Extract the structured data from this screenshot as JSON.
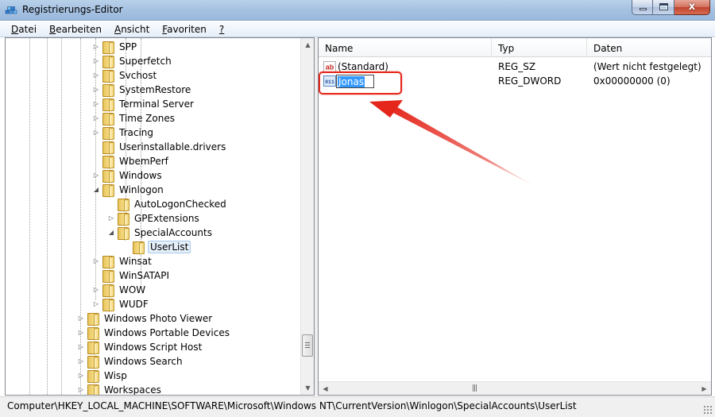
{
  "window": {
    "title": "Registrierungs-Editor",
    "close_glyph": "x"
  },
  "menu": [
    {
      "label": "Datei",
      "accel": "D",
      "rest": "atei"
    },
    {
      "label": "Bearbeiten",
      "accel": "B",
      "rest": "earbeiten"
    },
    {
      "label": "Ansicht",
      "accel": "A",
      "rest": "nsicht"
    },
    {
      "label": "Favoriten",
      "accel": "F",
      "rest": "avoriten"
    },
    {
      "label": "?",
      "accel": "?",
      "rest": ""
    }
  ],
  "tree": [
    {
      "label": "SPP",
      "depth": 1,
      "expander": "closed"
    },
    {
      "label": "Superfetch",
      "depth": 1,
      "expander": "closed"
    },
    {
      "label": "Svchost",
      "depth": 1,
      "expander": "closed"
    },
    {
      "label": "SystemRestore",
      "depth": 1,
      "expander": "closed"
    },
    {
      "label": "Terminal Server",
      "depth": 1,
      "expander": "closed"
    },
    {
      "label": "Time Zones",
      "depth": 1,
      "expander": "closed"
    },
    {
      "label": "Tracing",
      "depth": 1,
      "expander": "closed"
    },
    {
      "label": "Userinstallable.drivers",
      "depth": 1,
      "expander": "none"
    },
    {
      "label": "WbemPerf",
      "depth": 1,
      "expander": "none"
    },
    {
      "label": "Windows",
      "depth": 1,
      "expander": "closed"
    },
    {
      "label": "Winlogon",
      "depth": 1,
      "expander": "open"
    },
    {
      "label": "AutoLogonChecked",
      "depth": 2,
      "expander": "none"
    },
    {
      "label": "GPExtensions",
      "depth": 2,
      "expander": "closed"
    },
    {
      "label": "SpecialAccounts",
      "depth": 2,
      "expander": "open"
    },
    {
      "label": "UserList",
      "depth": 3,
      "expander": "none",
      "selected": true
    },
    {
      "label": "Winsat",
      "depth": 1,
      "expander": "closed"
    },
    {
      "label": "WinSATAPI",
      "depth": 1,
      "expander": "none"
    },
    {
      "label": "WOW",
      "depth": 1,
      "expander": "closed"
    },
    {
      "label": "WUDF",
      "depth": 1,
      "expander": "closed"
    },
    {
      "label": "Windows Photo Viewer",
      "depth": 0,
      "expander": "closed"
    },
    {
      "label": "Windows Portable Devices",
      "depth": 0,
      "expander": "closed"
    },
    {
      "label": "Windows Script Host",
      "depth": 0,
      "expander": "closed"
    },
    {
      "label": "Windows Search",
      "depth": 0,
      "expander": "closed"
    },
    {
      "label": "Wisp",
      "depth": 0,
      "expander": "closed"
    },
    {
      "label": "Workspaces",
      "depth": 0,
      "expander": "closed"
    }
  ],
  "list": {
    "columns": [
      "Name",
      "Typ",
      "Daten"
    ],
    "rows": [
      {
        "icon": "string-value-icon",
        "icon_text": "ab",
        "name": "(Standard)",
        "type": "REG_SZ",
        "data": "(Wert nicht festgelegt)"
      },
      {
        "icon": "dword-value-icon",
        "icon_text": "011",
        "name": "Jonas",
        "type": "REG_DWORD",
        "data": "0x00000000 (0)",
        "renaming": true
      }
    ]
  },
  "annotation": {
    "color": "#e4261b"
  },
  "status": {
    "path": "Computer\\HKEY_LOCAL_MACHINE\\SOFTWARE\\Microsoft\\Windows NT\\CurrentVersion\\Winlogon\\SpecialAccounts\\UserList"
  },
  "colors": {
    "selection": "#3399ff",
    "tree_selected_bg": "#e6f0fa",
    "titlebar": "#a9c4e3"
  }
}
